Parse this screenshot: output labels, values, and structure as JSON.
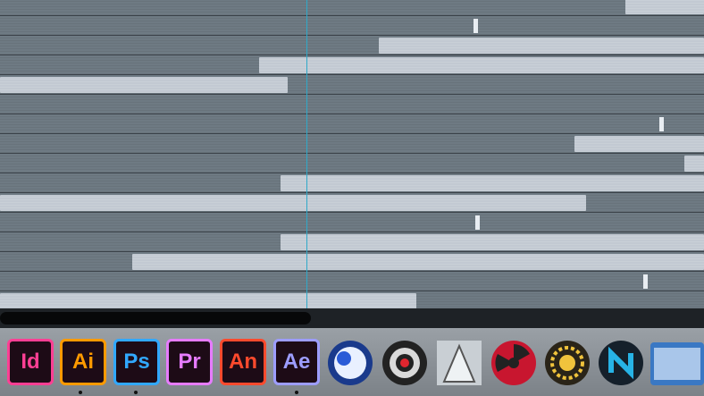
{
  "dock": {
    "apps": [
      {
        "label": "Id",
        "color": "#ff3f94",
        "running": true
      },
      {
        "label": "Ai",
        "color": "#ff9a00",
        "running": true
      },
      {
        "label": "Ps",
        "color": "#31a8ff",
        "running": false
      },
      {
        "label": "Pr",
        "color": "#e77cff",
        "running": false
      },
      {
        "label": "An",
        "color": "#ff4a2d",
        "running": false
      },
      {
        "label": "Ae",
        "color": "#9d9dff",
        "running": true
      }
    ],
    "other_apps": [
      "cinema4d-icon",
      "camera-lens-icon",
      "dragon-icon",
      "radiation-icon",
      "sun-gear-icon",
      "n-logo-icon",
      "rf-icon"
    ]
  },
  "colors": {
    "track": "#6e7a83",
    "bar": "#c2c9d2",
    "playhead": "#2fa9c9"
  }
}
